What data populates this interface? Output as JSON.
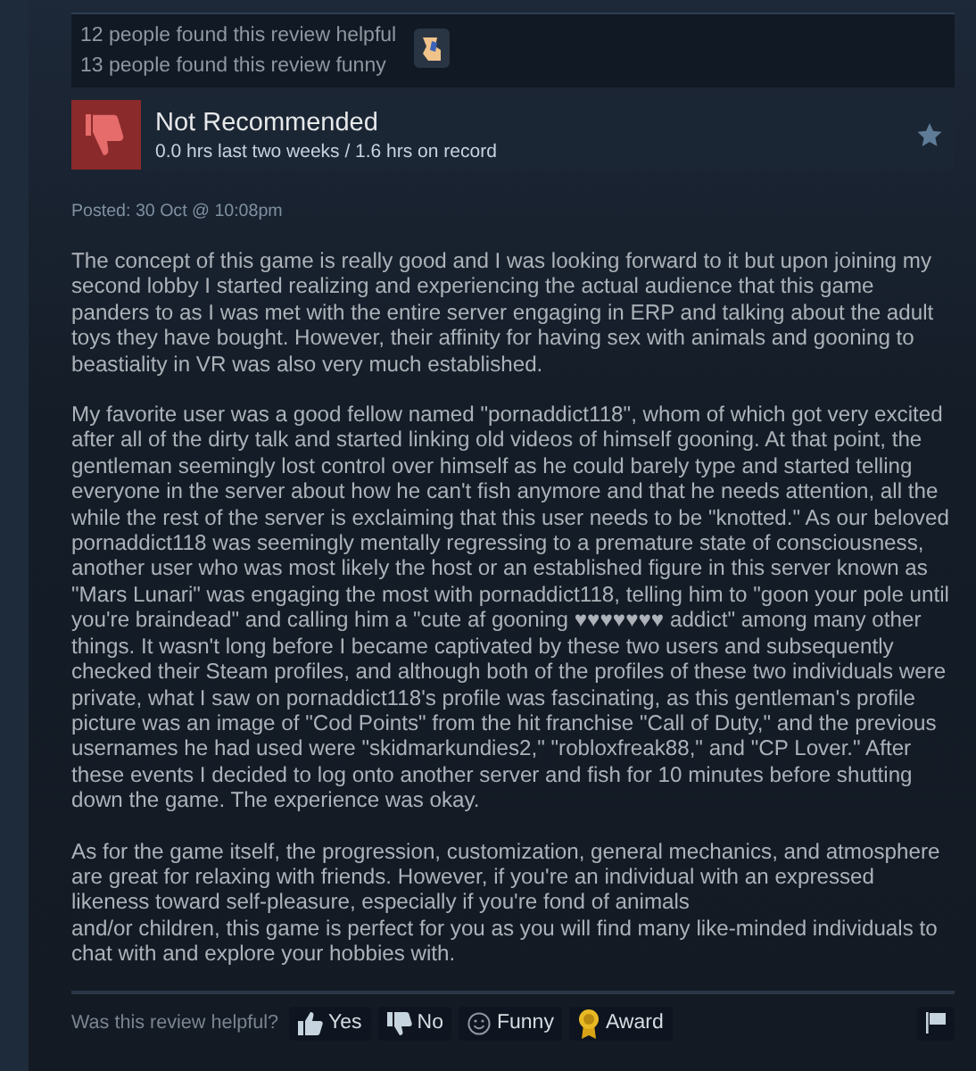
{
  "helpful_summary": {
    "lines": [
      "12 people found this review helpful",
      "13 people found this review funny"
    ]
  },
  "review": {
    "verdict": "Not Recommended",
    "recommended": false,
    "hours": "0.0 hrs last two weeks / 1.6 hrs on record",
    "posted": "Posted: 30 Oct @ 10:08pm",
    "paragraphs": [
      "The concept of this game is really good and I was looking forward to it but upon joining my second lobby I started realizing and experiencing the actual audience that this game panders to as I was met with the entire server engaging in ERP and talking about the adult toys they have bought. However, their affinity for having sex with animals and gooning to beastiality in VR was also very much established.",
      "My favorite user was a good fellow named \"pornaddict118\", whom of which got very excited after all of the dirty talk and started linking old videos of himself gooning. At that point, the gentleman seemingly lost control over himself as he could barely type and started telling everyone in the server about how he can't fish anymore and that he needs attention, all the while the rest of the server is exclaiming that this user needs to be \"knotted.\" As our beloved pornaddict118 was seemingly mentally regressing to a premature state of consciousness, another user who was most likely the host or an established figure in this server known as \"Mars Lunari\" was engaging the most with pornaddict118, telling him to \"goon your pole until you're braindead\" and calling him a \"cute af gooning ♥♥♥♥♥♥♥ addict\" among many other things. It wasn't long before I became captivated by these two users and subsequently checked their Steam profiles, and although both of the profiles of these two individuals were private, what I saw on pornaddict118's profile was fascinating, as this gentleman's profile picture was an image of \"Cod Points\" from the hit franchise \"Call of Duty,\" and the previous usernames he had used were \"skidmarkundies2,\" \"robloxfreak88,\" and \"CP Lover.\" After these events I decided to log onto another server and fish for 10 minutes before shutting down the game. The experience was okay.",
      "As for the game itself, the progression, customization, general mechanics, and atmosphere are great for relaxing with friends. However, if you're an individual with an expressed likeness toward self-pleasure, especially if you're fond of animals\nand/or children, this game is perfect for you as you will find many like-minded individuals to chat with and explore your hobbies with."
    ]
  },
  "feedback": {
    "question": "Was this review helpful?",
    "buttons": [
      {
        "kind": "yes",
        "label": "Yes"
      },
      {
        "kind": "no",
        "label": "No"
      },
      {
        "kind": "funny",
        "label": "Funny"
      },
      {
        "kind": "award",
        "label": "Award"
      }
    ]
  }
}
